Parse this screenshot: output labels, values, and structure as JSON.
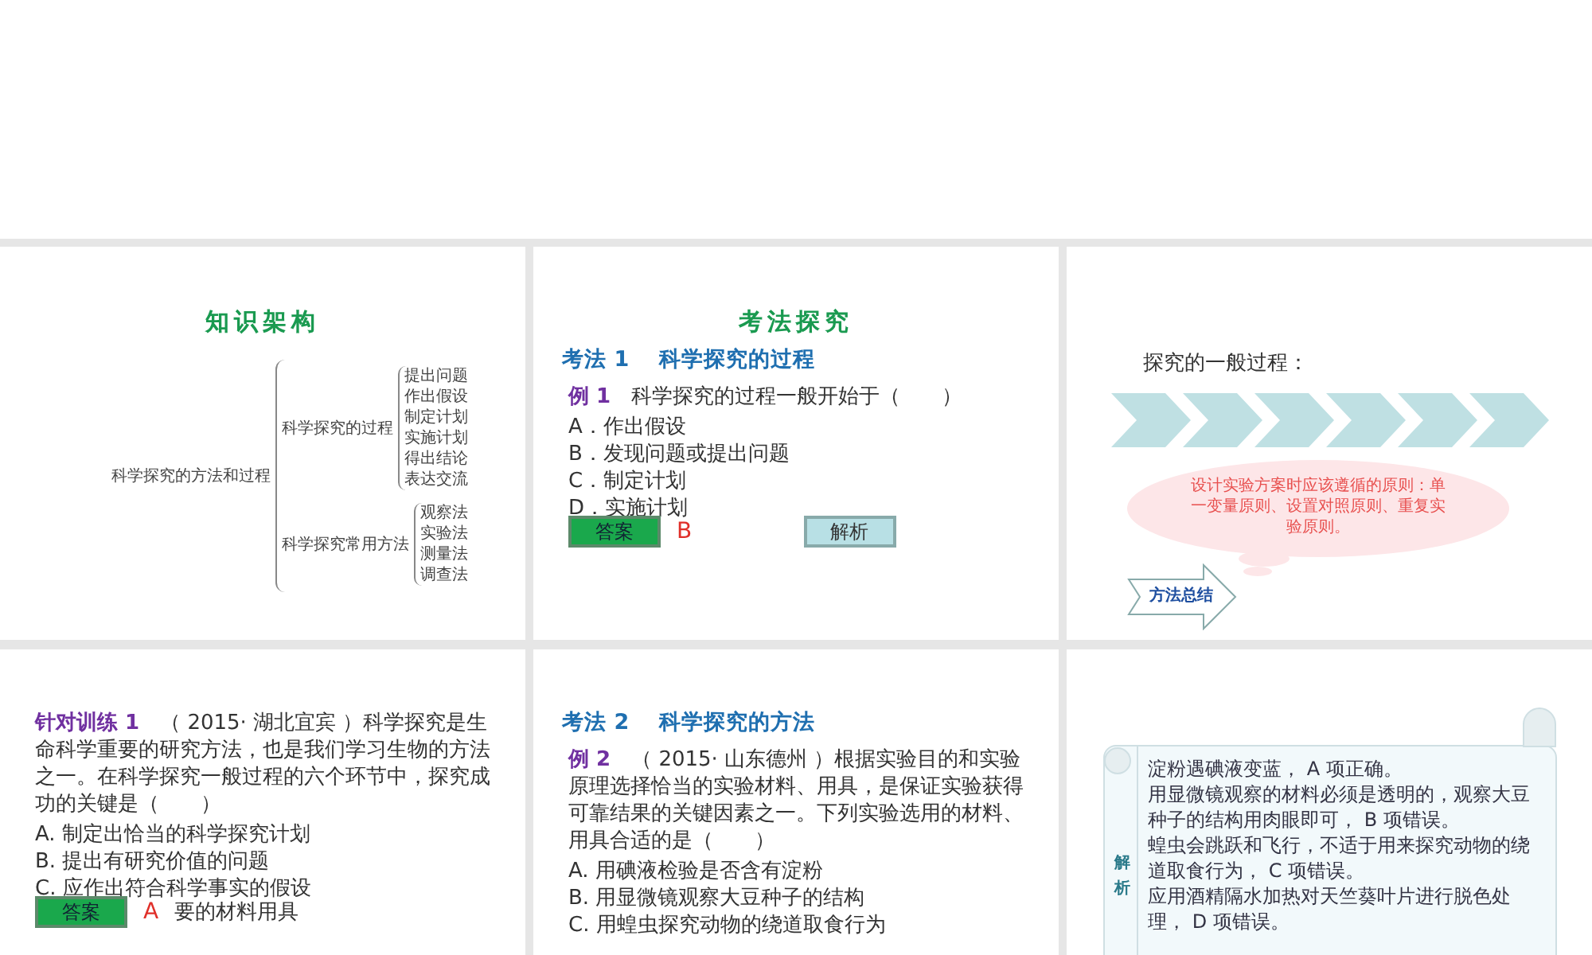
{
  "slides": [
    {
      "kind": "mindmap",
      "title": "知识架构",
      "root": "科学探究的方法和过程",
      "branches": [
        {
          "label": "科学探究的过程",
          "children": [
            "提出问题",
            "作出假设",
            "制定计划",
            "实施计划",
            "得出结论",
            "表达交流"
          ]
        },
        {
          "label": "科学探究常用方法",
          "children": [
            "观察法",
            "实验法",
            "测量法",
            "调查法"
          ]
        }
      ]
    },
    {
      "kind": "example",
      "title": "考法探究",
      "heading": "考法 1　 科学探究的过程",
      "example_label": "例 1",
      "question": "　科学探究的过程一般开始于（　　）",
      "options": [
        "A．作出假设",
        "B．发现问题或提出问题",
        "C．制定计划",
        "D．实施计划"
      ],
      "answer_button": "答案",
      "answer": "B",
      "analysis_button": "解析"
    },
    {
      "kind": "summary",
      "text": "探究的一般过程：",
      "cloud_text": "设计实验方案时应该遵循的原则：单一变量原则、设置对照原则、重复实验原则。",
      "tag": "方法总结"
    },
    {
      "kind": "exercise",
      "example_label": "针对训练 1",
      "question": "　（ 2015· 湖北宜宾 ）科学探究是生命科学重要的研究方法，也是我们学习生物的方法之一。在科学探究一般过程的六个环节中，探究成功的关键是（　　）",
      "options": [
        "A. 制定出恰当的科学探究计划",
        "B. 提出有研究价值的问题",
        "C. 应作出符合科学事实的假设"
      ],
      "answer_button": "答案",
      "answer": "A",
      "partial_option": "要的材料用具"
    },
    {
      "kind": "example",
      "heading": "考法 2　 科学探究的方法",
      "example_label": "例 2",
      "question": "　（ 2015· 山东德州 ）根据实验目的和实验原理选择恰当的实验材料、用具，是保证实验获得可靠结果的关键因素之一。下列实验选用的材料、用具合适的是（　　）",
      "options": [
        "A. 用碘液检验是否含有淀粉",
        "B. 用显微镜观察大豆种子的结构",
        "C. 用蝗虫探究动物的绕道取食行为"
      ]
    },
    {
      "kind": "analysis",
      "label": "解析",
      "lines": [
        "淀粉遇碘液变蓝， A 项正确。",
        "用显微镜观察的材料必须是透明的，观察大豆种子的结构用肉眼即可， B 项错误。",
        "蝗虫会跳跃和飞行，不适于用来探究动物的绕道取食行为， C 项错误。",
        "应用酒精隔水加热对天竺葵叶片进行脱色处理， D 项错误。"
      ]
    }
  ]
}
